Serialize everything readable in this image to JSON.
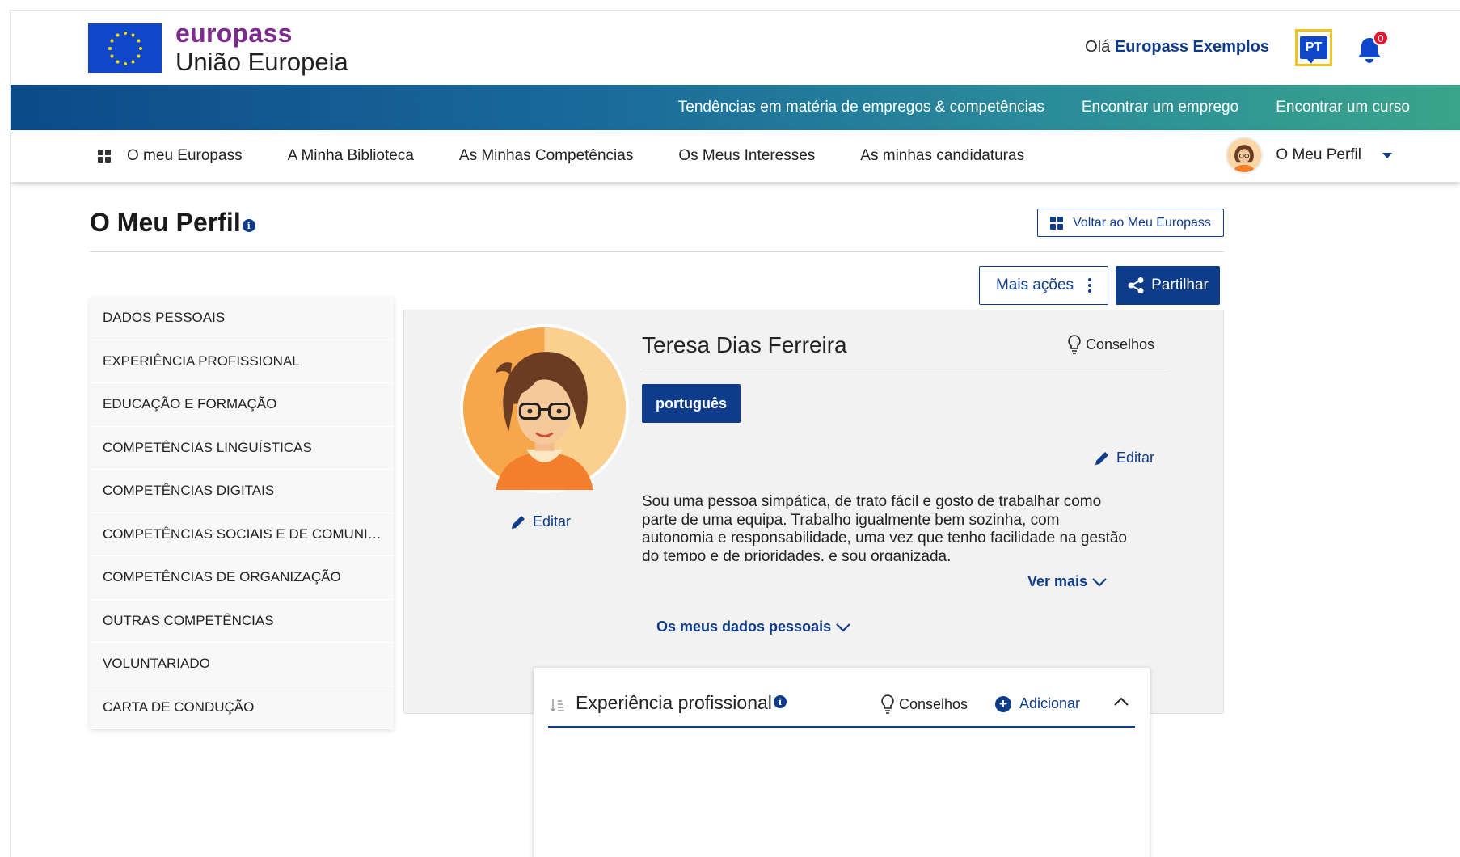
{
  "header": {
    "brand_name": "europass",
    "brand_sub": "União Europeia",
    "greeting": "Olá",
    "user_name": "Europass Exemplos",
    "language_code": "PT",
    "notifications_count": "0"
  },
  "gradient_nav": [
    {
      "label": "Tendências em matéria de empregos & competências"
    },
    {
      "label": "Encontrar um emprego"
    },
    {
      "label": "Encontrar um curso"
    }
  ],
  "subnav": {
    "items": [
      {
        "label": "O meu Europass"
      },
      {
        "label": "A Minha Biblioteca"
      },
      {
        "label": "As Minhas Competências"
      },
      {
        "label": "Os Meus Interesses"
      },
      {
        "label": "As minhas candidaturas"
      }
    ],
    "profile_label": "O Meu Perfil"
  },
  "page": {
    "title": "O Meu Perfil",
    "back_label": "Voltar ao Meu Europass",
    "more_actions": "Mais ações",
    "share": "Partilhar"
  },
  "sidebar": {
    "items": [
      {
        "label": "DADOS PESSOAIS"
      },
      {
        "label": "EXPERIÊNCIA PROFISSIONAL"
      },
      {
        "label": "EDUCAÇÃO E FORMAÇÃO"
      },
      {
        "label": "COMPETÊNCIAS LINGUÍSTICAS"
      },
      {
        "label": "COMPETÊNCIAS DIGITAIS"
      },
      {
        "label": "COMPETÊNCIAS SOCIAIS E DE COMUNI…"
      },
      {
        "label": "COMPETÊNCIAS DE ORGANIZAÇÃO"
      },
      {
        "label": "OUTRAS COMPETÊNCIAS"
      },
      {
        "label": "VOLUNTARIADO"
      },
      {
        "label": "CARTA DE CONDUÇÃO"
      }
    ]
  },
  "profile": {
    "name": "Teresa Dias Ferreira",
    "tips": "Conselhos",
    "language_chip": "português",
    "edit_label": "Editar",
    "about": "Sou uma pessoa simpática, de trato fácil e gosto de trabalhar como parte de uma equipa. Trabalho igualmente bem sozinha, com autonomia e responsabilidade, uma vez que tenho facilidade na gestão do tempo e de prioridades, e sou organizada.",
    "see_more": "Ver mais",
    "personal_data": "Os meus dados pessoais"
  },
  "experience": {
    "title": "Experiência profissional",
    "tips": "Conselhos",
    "add": "Adicionar"
  },
  "colors": {
    "brand_purple": "#7e2a8e",
    "primary_blue": "#0f3c8a",
    "eu_blue": "#0e47cb",
    "notification_red": "#e3132b",
    "focus_yellow": "#f0c419"
  },
  "icons": [
    "eu-flag-icon",
    "language-bubble-icon",
    "bell-icon",
    "grid-icon",
    "chevron-down-icon",
    "info-icon",
    "kebab-icon",
    "share-icon",
    "pencil-icon",
    "lightbulb-icon",
    "sort-icon",
    "plus-circle-icon",
    "chevron-up-icon"
  ]
}
